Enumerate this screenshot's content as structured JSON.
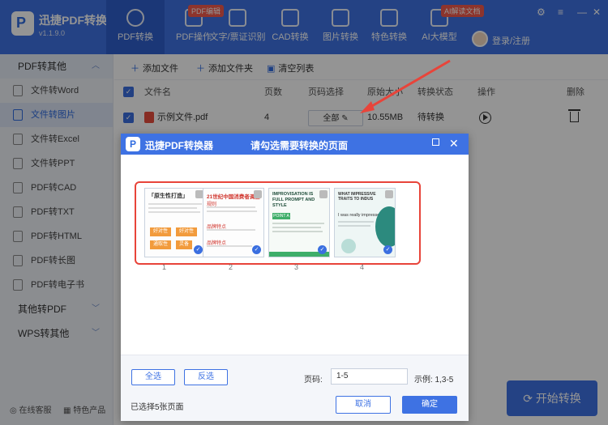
{
  "app": {
    "name": "迅捷PDF转换器",
    "version": "v1.1.9.0",
    "logo_glyph": "P"
  },
  "nav": {
    "items": [
      {
        "label": "PDF转换",
        "active": true
      },
      {
        "label": "PDF操作",
        "badge": "PDF编辑"
      },
      {
        "label": "文字/票证识别"
      },
      {
        "label": "CAD转换"
      },
      {
        "label": "图片转换"
      },
      {
        "label": "特色转换"
      },
      {
        "label": "AI大模型",
        "badge": "AI解读文档"
      }
    ],
    "login": "登录/注册"
  },
  "sidebar": {
    "group1": "PDF转其他",
    "items": [
      "文件转Word",
      "文件转图片",
      "文件转Excel",
      "文件转PPT",
      "PDF转CAD",
      "PDF转TXT",
      "PDF转HTML",
      "PDF转长图",
      "PDF转电子书"
    ],
    "active_index": 1,
    "group2": "其他转PDF",
    "group3": "WPS转其他",
    "footer_service": "在线客服",
    "footer_products": "特色产品"
  },
  "toolbar": {
    "add_file": "添加文件",
    "add_folder": "添加文件夹",
    "clear_list": "清空列表"
  },
  "table": {
    "headers": {
      "name": "文件名",
      "pages": "页数",
      "page_select": "页码选择",
      "size": "原始大小",
      "status": "转换状态",
      "action": "操作",
      "delete": "删除"
    },
    "row": {
      "name": "示例文件.pdf",
      "pages": "4",
      "page_select": "全部",
      "size": "10.55MB",
      "status": "待转换"
    }
  },
  "start_button": "开始转换",
  "dialog": {
    "app": "迅捷PDF转换器",
    "title": "请勾选需要转换的页面",
    "pages": [
      {
        "num": "1",
        "heading": "「原生性打造」",
        "tiles": [
          "好对性",
          "好对性",
          "通取性",
          "灵备"
        ]
      },
      {
        "num": "2",
        "heading": "21世纪中国消费者调查",
        "sub1": "规则",
        "sub2": "品牌特点",
        "sub3": "品牌特点"
      },
      {
        "num": "3",
        "heading": "IMPROVISATION IS FULL PROMPT AND STYLE",
        "point": "POINT A"
      },
      {
        "num": "4",
        "heading": "WHAT IMPRESSIVE TRAITS TO INDUS",
        "quote": "I was really impressed"
      }
    ],
    "select_all": "全选",
    "invert": "反选",
    "page_label": "页码:",
    "page_value": "1-5",
    "example": "示例: 1,3-5",
    "selected_info": "已选择5张页面",
    "cancel": "取消",
    "ok": "确定"
  },
  "colors": {
    "primary": "#3e72e3",
    "highlight_red": "#e8443a"
  }
}
